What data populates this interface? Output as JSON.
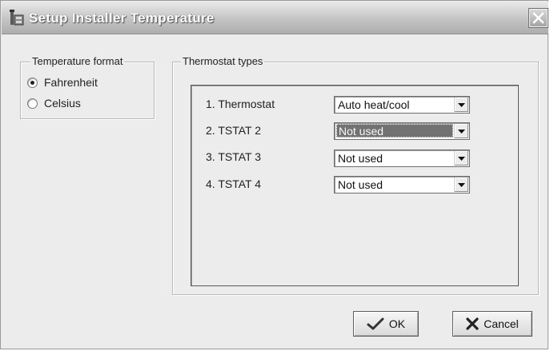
{
  "window": {
    "title": "Setup Installer Temperature",
    "icons": {
      "app": "installer-tool-icon",
      "close": "close-icon"
    }
  },
  "temperature_format": {
    "legend": "Temperature format",
    "options": [
      {
        "label": "Fahrenheit",
        "checked": true
      },
      {
        "label": "Celsius",
        "checked": false
      }
    ]
  },
  "thermostat_types": {
    "legend": "Thermostat types",
    "rows": [
      {
        "label": "1. Thermostat",
        "value": "Auto heat/cool",
        "focused": false
      },
      {
        "label": "2. TSTAT 2",
        "value": "Not used",
        "focused": true
      },
      {
        "label": "3. TSTAT 3",
        "value": "Not used",
        "focused": false
      },
      {
        "label": "4. TSTAT 4",
        "value": "Not used",
        "focused": false
      }
    ]
  },
  "buttons": {
    "ok": {
      "label": "OK",
      "icon": "checkmark-icon"
    },
    "cancel": {
      "label": "Cancel",
      "icon": "x-mark-icon"
    }
  },
  "colors": {
    "selection": "#727272",
    "window_bg": "#ececec"
  }
}
